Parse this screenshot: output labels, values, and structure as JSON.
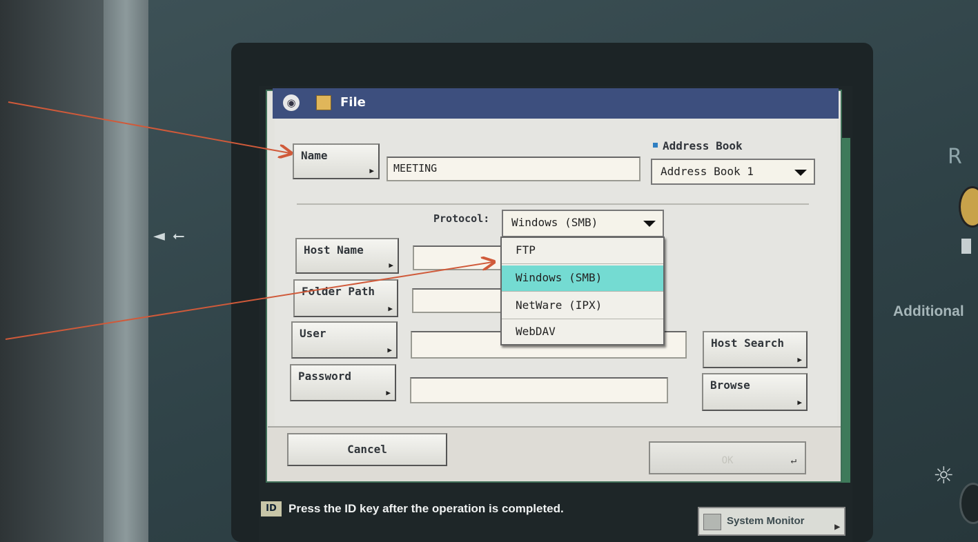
{
  "panel": {
    "usb_label": "◄ ⭠",
    "side_label_r": "R",
    "side_label_additional": "Additional",
    "brightness_icon": "sun-icon"
  },
  "dialog": {
    "title": "File",
    "name_button": "Name",
    "name_value": "MEETING",
    "address_book_label": "Address Book",
    "address_book_selected": "Address Book 1",
    "protocol_label": "Protocol:",
    "protocol_selected": "Windows (SMB)",
    "protocol_options": [
      "FTP",
      "Windows (SMB)",
      "NetWare (IPX)",
      "WebDAV"
    ],
    "protocol_highlighted_index": 1,
    "host_name_button": "Host Name",
    "folder_path_button": "Folder Path",
    "user_button": "User",
    "password_button": "Password",
    "host_name_value": "",
    "folder_path_value": "",
    "user_value": "",
    "password_value": "",
    "host_search_button": "Host Search",
    "browse_button": "Browse",
    "cancel_button": "Cancel",
    "ok_button": "OK"
  },
  "status_bar": {
    "id_badge": "ID",
    "message": "Press the ID key after the operation is completed.",
    "system_monitor_button": "System Monitor"
  },
  "colors": {
    "title_bar": "#3d4f7e",
    "selected_option": "#74dbd2",
    "annotation_arrow": "#d05a3a"
  }
}
